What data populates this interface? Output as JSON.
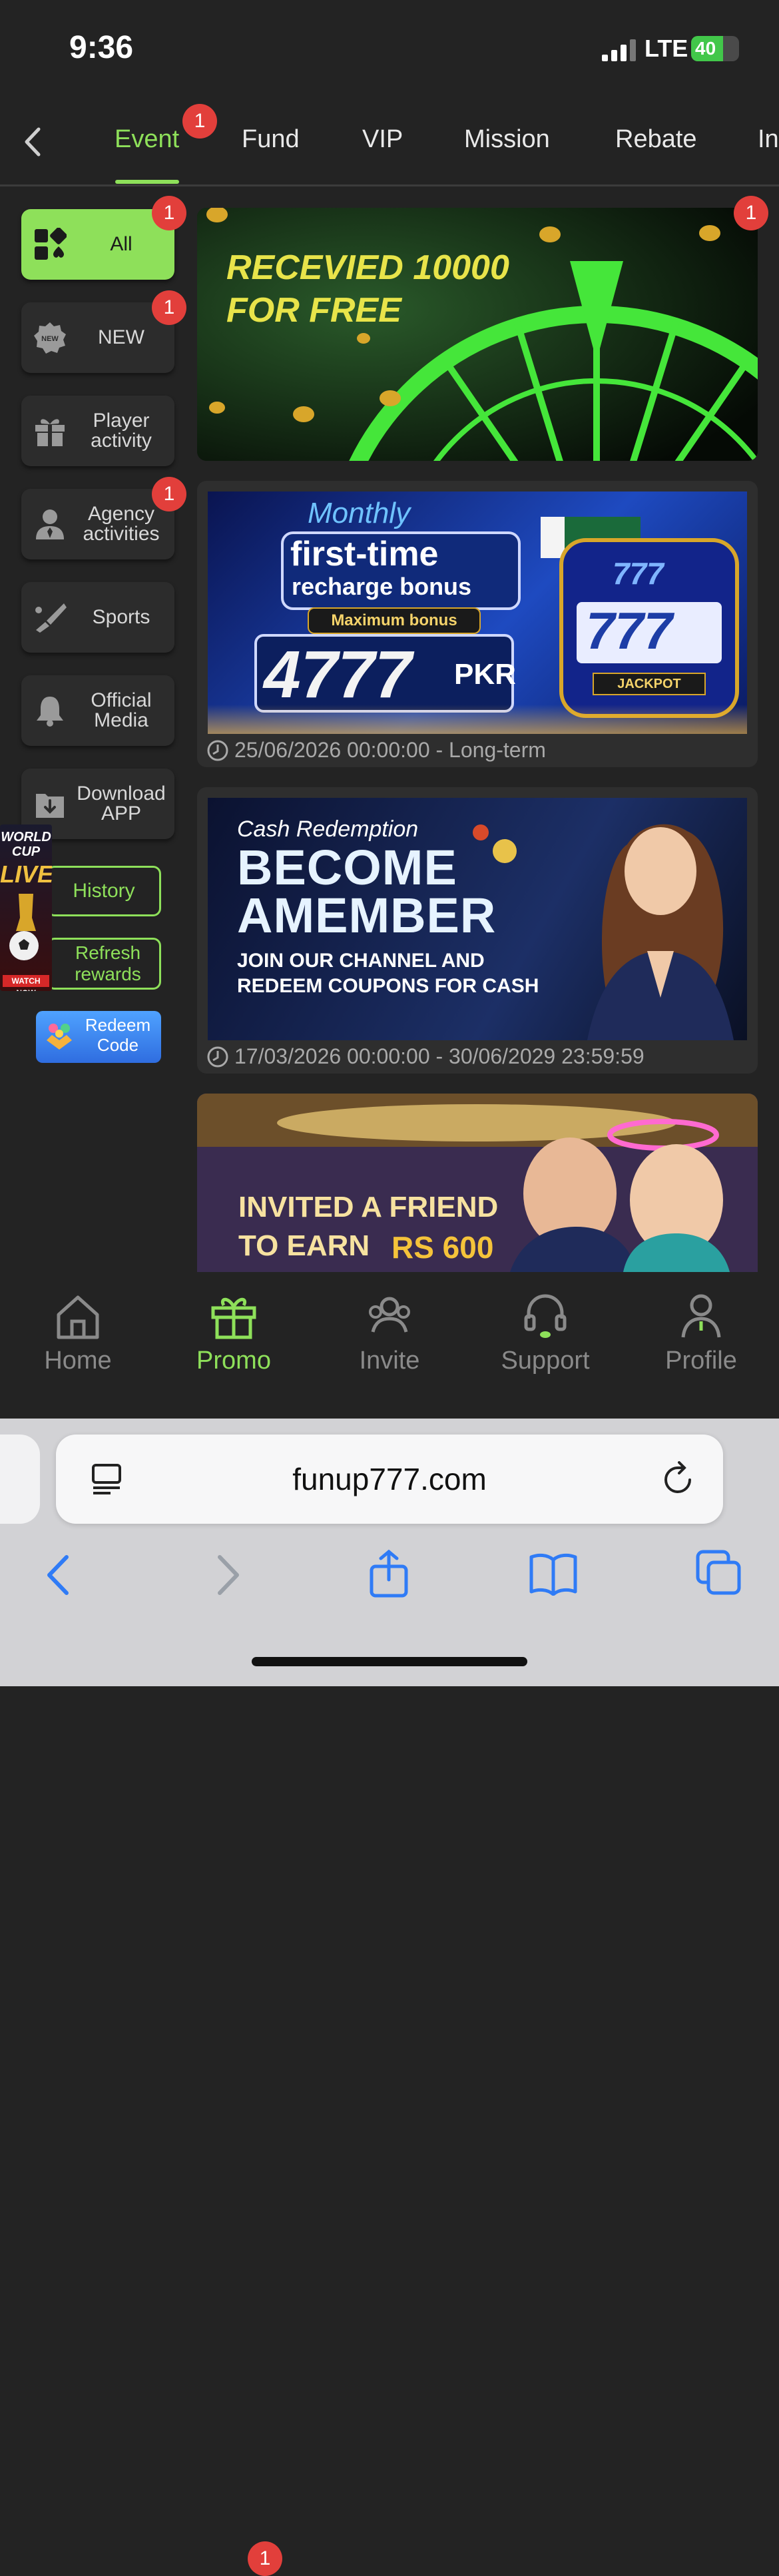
{
  "status_bar": {
    "time": "9:36",
    "network": "LTE",
    "battery": "40"
  },
  "tabs": {
    "items": [
      {
        "label": "Event",
        "active": true,
        "badge": "1"
      },
      {
        "label": "Fund"
      },
      {
        "label": "VIP"
      },
      {
        "label": "Mission"
      },
      {
        "label": "Rebate"
      },
      {
        "label": "In"
      }
    ]
  },
  "sidebar": {
    "items": [
      {
        "label": "All",
        "icon": "grid-icon",
        "active": true,
        "badge": "1"
      },
      {
        "label": "NEW",
        "icon": "new-seal-icon",
        "badge": "1",
        "icon_text": "NEW"
      },
      {
        "label": "Player activity",
        "icon": "gift-icon"
      },
      {
        "label": "Agency activities",
        "icon": "agent-icon",
        "badge": "1"
      },
      {
        "label": "Sports",
        "icon": "sports-icon"
      },
      {
        "label": "Official Media",
        "icon": "bell-icon"
      },
      {
        "label": "Download APP",
        "icon": "download-icon"
      }
    ],
    "history": "History",
    "refresh": "Refresh rewards",
    "redeem": "Redeem Code"
  },
  "floating": {
    "world_cup": [
      "WORLD",
      "CUP",
      "LIVE",
      "WATCH NOW"
    ]
  },
  "events": [
    {
      "badge": "1",
      "banner_lines": [
        "RECEVIED 10000",
        "FOR FREE"
      ]
    },
    {
      "banner_lines": [
        "Monthly",
        "first-time",
        "recharge bonus",
        "Maximum bonus",
        "4777",
        "PKR",
        "JACKPOT",
        "777"
      ],
      "date": "25/06/2026 00:00:00 - Long-term"
    },
    {
      "banner_lines": [
        "Cash Redemption",
        "BECOME",
        "AMEMBER",
        "JOIN OUR CHANNEL AND",
        "REDEEM COUPONS FOR CASH"
      ],
      "date": "17/03/2026 00:00:00 - 30/06/2029 23:59:59"
    },
    {
      "banner_lines": [
        "INVITED A FRIEND",
        "TO EARN",
        "RS 600"
      ]
    }
  ],
  "bottom_nav": {
    "items": [
      {
        "label": "Home",
        "icon": "home-icon"
      },
      {
        "label": "Promo",
        "icon": "gift-icon",
        "active": true,
        "badge": "1"
      },
      {
        "label": "Invite",
        "icon": "people-icon"
      },
      {
        "label": "Support",
        "icon": "headset-icon"
      },
      {
        "label": "Profile",
        "icon": "person-icon"
      }
    ]
  },
  "browser": {
    "url": "funup777.com"
  },
  "colors": {
    "accent": "#8ee05a",
    "badge": "#e23f3b",
    "background": "#232323",
    "ios_blue": "#2f7bf6"
  }
}
